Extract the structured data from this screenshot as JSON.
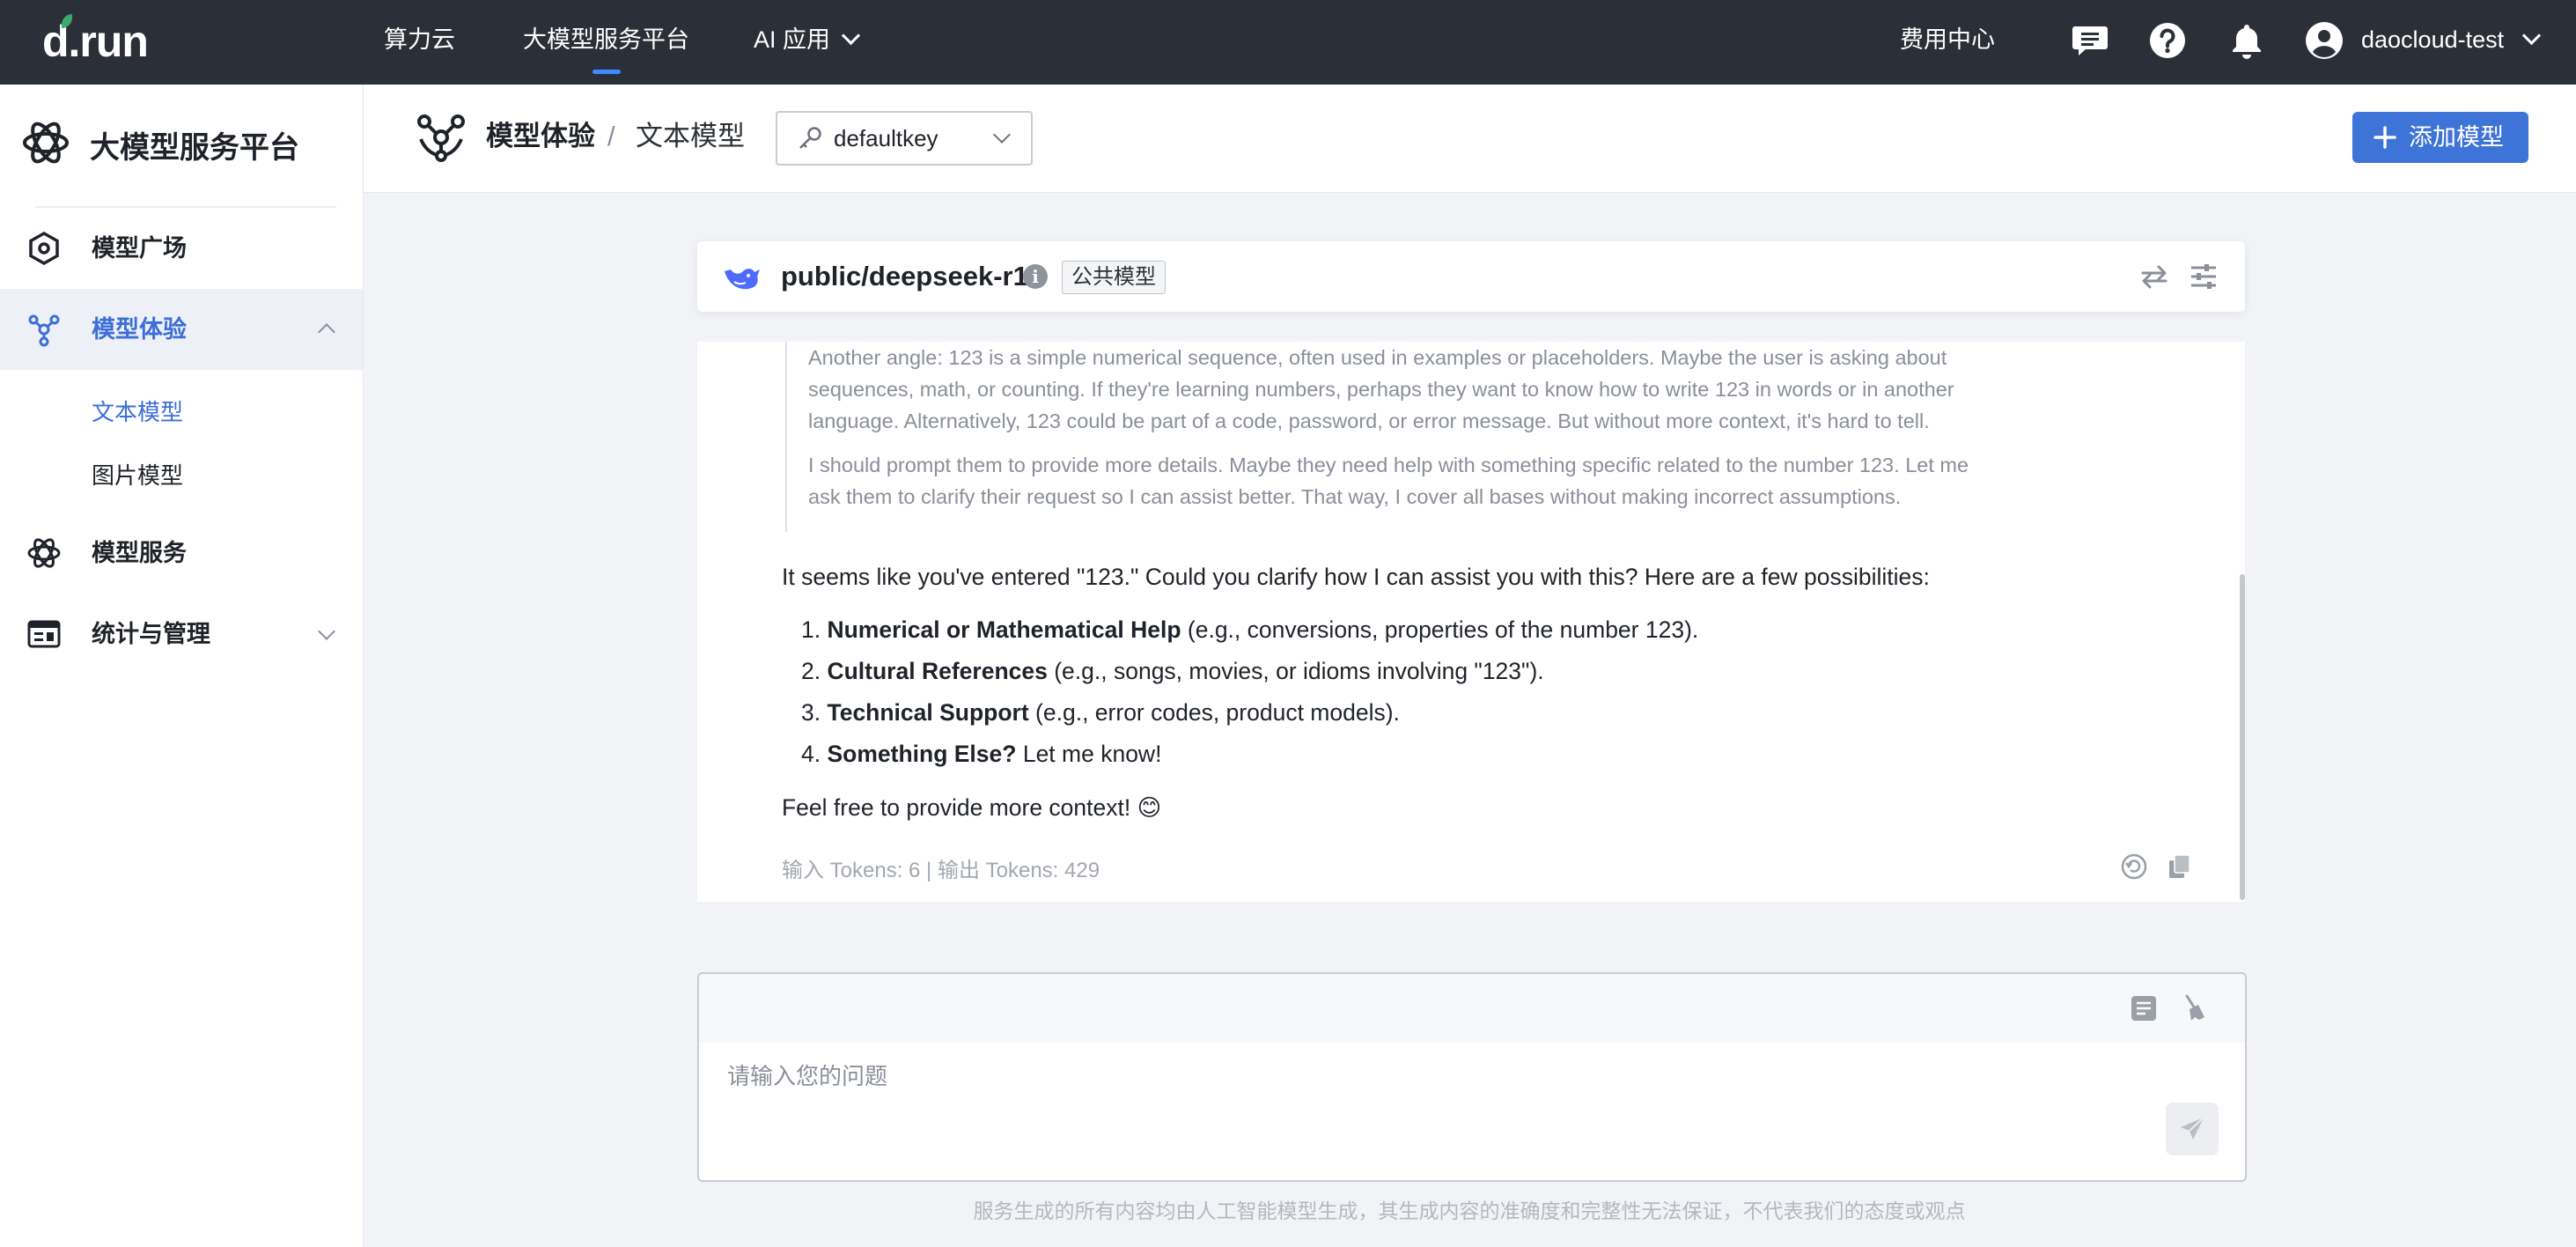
{
  "topbar": {
    "logo": "d.run",
    "nav": [
      "算力云",
      "大模型服务平台",
      "AI 应用"
    ],
    "active_nav": "大模型服务平台",
    "billing": "费用中心",
    "user": "daocloud-test"
  },
  "sidebar": {
    "title": "大模型服务平台",
    "items": [
      {
        "label": "模型广场"
      },
      {
        "label": "模型体验"
      },
      {
        "label": "模型服务"
      },
      {
        "label": "统计与管理"
      }
    ],
    "sub_items": [
      {
        "label": "文本模型"
      },
      {
        "label": "图片模型"
      }
    ]
  },
  "header": {
    "breadcrumb_parent": "模型体验",
    "breadcrumb_sep": "/",
    "breadcrumb_current": "文本模型",
    "api_key": "defaultkey",
    "add_model": "添加模型"
  },
  "model": {
    "name": "public/deepseek-r1",
    "tag": "公共模型"
  },
  "chat": {
    "thinking": [
      "Another angle: 123 is a simple numerical sequence, often used in examples or placeholders. Maybe the user is asking about sequences, math, or counting. If they're learning numbers, perhaps they want to know how to write 123 in words or in another language. Alternatively, 123 could be part of a code, password, or error message. But without more context, it's hard to tell.",
      "I should prompt them to provide more details. Maybe they need help with something specific related to the number 123. Let me ask them to clarify their request so I can assist better. That way, I cover all bases without making incorrect assumptions."
    ],
    "intro": "It seems like you've entered \"123.\" Could you clarify how I can assist you with this? Here are a few possibilities:",
    "list": [
      {
        "num": "1.",
        "bold": "Numerical or Mathematical Help",
        "rest": " (e.g., conversions, properties of the number 123)."
      },
      {
        "num": "2.",
        "bold": "Cultural References",
        "rest": " (e.g., songs, movies, or idioms involving \"123\")."
      },
      {
        "num": "3.",
        "bold": "Technical Support",
        "rest": " (e.g., error codes, product models)."
      },
      {
        "num": "4.",
        "bold": "Something Else?",
        "rest": " Let me know!"
      }
    ],
    "closing": "Feel free to provide more context! 😊",
    "tokens": "输入 Tokens: 6 | 输出 Tokens: 429"
  },
  "input": {
    "placeholder": "请输入您的问题"
  },
  "disclaimer": "服务生成的所有内容均由人工智能模型生成，其生成内容的准确度和完整性无法保证，不代表我们的态度或观点",
  "colors": {
    "topbar_bg": "#2b2f37",
    "accent": "#3e73d8",
    "active_text": "#3d6ed8"
  }
}
